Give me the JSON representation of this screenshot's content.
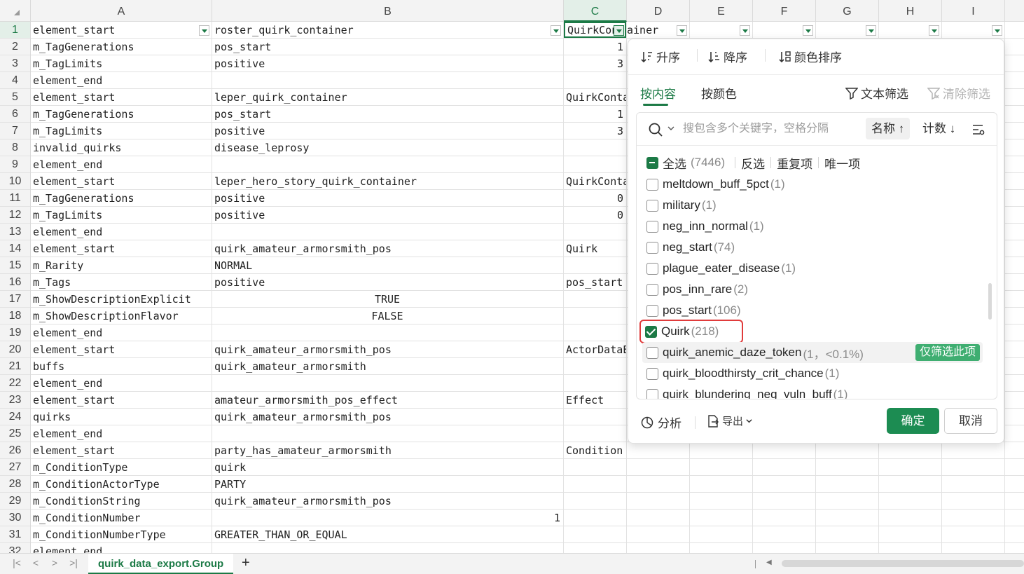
{
  "sheet": {
    "columns": [
      "A",
      "B",
      "C",
      "D",
      "E",
      "F",
      "G",
      "H",
      "I"
    ],
    "selected_column": "C",
    "rows": [
      {
        "n": "1",
        "a": "element_start",
        "b": "roster_quirk_container",
        "c": "QuirkContainer",
        "c_num": false
      },
      {
        "n": "2",
        "a": "m_TagGenerations",
        "b": "pos_start",
        "c": "1",
        "c_num": true
      },
      {
        "n": "3",
        "a": "m_TagLimits",
        "b": "positive",
        "c": "3",
        "c_num": true
      },
      {
        "n": "4",
        "a": "element_end",
        "b": "",
        "c": ""
      },
      {
        "n": "5",
        "a": "element_start",
        "b": "leper_quirk_container",
        "c": "QuirkConta"
      },
      {
        "n": "6",
        "a": "m_TagGenerations",
        "b": "pos_start",
        "c": "1",
        "c_num": true
      },
      {
        "n": "7",
        "a": "m_TagLimits",
        "b": "positive",
        "c": "3",
        "c_num": true
      },
      {
        "n": "8",
        "a": "invalid_quirks",
        "b": "disease_leprosy",
        "c": ""
      },
      {
        "n": "9",
        "a": "element_end",
        "b": "",
        "c": ""
      },
      {
        "n": "10",
        "a": "element_start",
        "b": "leper_hero_story_quirk_container",
        "c": "QuirkConta"
      },
      {
        "n": "11",
        "a": "m_TagGenerations",
        "b": "positive",
        "c": "0",
        "c_num": true
      },
      {
        "n": "12",
        "a": "m_TagLimits",
        "b": "positive",
        "c": "0",
        "c_num": true
      },
      {
        "n": "13",
        "a": "element_end",
        "b": "",
        "c": ""
      },
      {
        "n": "14",
        "a": "element_start",
        "b": "quirk_amateur_armorsmith_pos",
        "c": "Quirk"
      },
      {
        "n": "15",
        "a": "m_Rarity",
        "b": "NORMAL",
        "c": ""
      },
      {
        "n": "16",
        "a": "m_Tags",
        "b": "positive",
        "c": "pos_start"
      },
      {
        "n": "17",
        "a": "m_ShowDescriptionExplicit",
        "b": "TRUE",
        "c": "",
        "b_ctr": true
      },
      {
        "n": "18",
        "a": "m_ShowDescriptionFlavor",
        "b": "FALSE",
        "c": "",
        "b_ctr": true
      },
      {
        "n": "19",
        "a": "element_end",
        "b": "",
        "c": ""
      },
      {
        "n": "20",
        "a": "element_start",
        "b": "quirk_amateur_armorsmith_pos",
        "c": "ActorDataE"
      },
      {
        "n": "21",
        "a": "buffs",
        "b": "quirk_amateur_armorsmith",
        "c": ""
      },
      {
        "n": "22",
        "a": "element_end",
        "b": "",
        "c": ""
      },
      {
        "n": "23",
        "a": "element_start",
        "b": "amateur_armorsmith_pos_effect",
        "c": "Effect"
      },
      {
        "n": "24",
        "a": "quirks",
        "b": "quirk_amateur_armorsmith_pos",
        "c": ""
      },
      {
        "n": "25",
        "a": "element_end",
        "b": "",
        "c": ""
      },
      {
        "n": "26",
        "a": "element_start",
        "b": "party_has_amateur_armorsmith",
        "c": "Condition"
      },
      {
        "n": "27",
        "a": "m_ConditionType",
        "b": "quirk",
        "c": ""
      },
      {
        "n": "28",
        "a": "m_ConditionActorType",
        "b": "PARTY",
        "c": ""
      },
      {
        "n": "29",
        "a": "m_ConditionString",
        "b": "quirk_amateur_armorsmith_pos",
        "c": ""
      },
      {
        "n": "30",
        "a": "m_ConditionNumber",
        "b": "1",
        "c": "",
        "b_num": true
      },
      {
        "n": "31",
        "a": "m_ConditionNumberType",
        "b": "GREATER_THAN_OR_EQUAL",
        "c": ""
      },
      {
        "n": "32",
        "a": "element_end",
        "b": "",
        "c": ""
      }
    ]
  },
  "tabs": {
    "sheet_name": "quirk_data_export.Group",
    "add_label": "+",
    "nav": [
      "|<",
      "<",
      ">",
      ">|"
    ]
  },
  "filter_panel": {
    "sort_asc": "升序",
    "sort_desc": "降序",
    "sort_color": "颜色排序",
    "tab_content": "按内容",
    "tab_color": "按颜色",
    "text_filter": "文本筛选",
    "clear_filter": "清除筛选",
    "search_placeholder": "搜包含多个关键字，空格分隔",
    "sort_name": "名称 ↑",
    "sort_count": "计数 ↓",
    "select_all": "全选",
    "select_all_count": "(7446)",
    "invert": "反选",
    "duplicates": "重复项",
    "unique": "唯一项",
    "items": [
      {
        "label": "meltdown_buff_5pct",
        "count": "(1)",
        "checked": false
      },
      {
        "label": "military",
        "count": "(1)",
        "checked": false
      },
      {
        "label": "neg_inn_normal",
        "count": "(1)",
        "checked": false
      },
      {
        "label": "neg_start",
        "count": "(74)",
        "checked": false
      },
      {
        "label": "plague_eater_disease",
        "count": "(1)",
        "checked": false
      },
      {
        "label": "pos_inn_rare",
        "count": "(2)",
        "checked": false
      },
      {
        "label": "pos_start",
        "count": "(106)",
        "checked": false
      },
      {
        "label": "Quirk",
        "count": "(218)",
        "checked": true
      },
      {
        "label": "quirk_anemic_daze_token",
        "count": "(1，<0.1%)",
        "checked": false
      },
      {
        "label": "quirk_bloodthirsty_crit_chance",
        "count": "(1)",
        "checked": false
      },
      {
        "label": "quirk_blundering_neg_vuln_buff",
        "count": "(1)",
        "checked": false
      }
    ],
    "only_this": "仅筛选此项",
    "analyze": "分析",
    "export": "导出",
    "ok": "确定",
    "cancel": "取消"
  },
  "colors": {
    "accent": "#1c7a46",
    "highlight_box": "#e03b3b",
    "only_btn": "#3fae71"
  }
}
